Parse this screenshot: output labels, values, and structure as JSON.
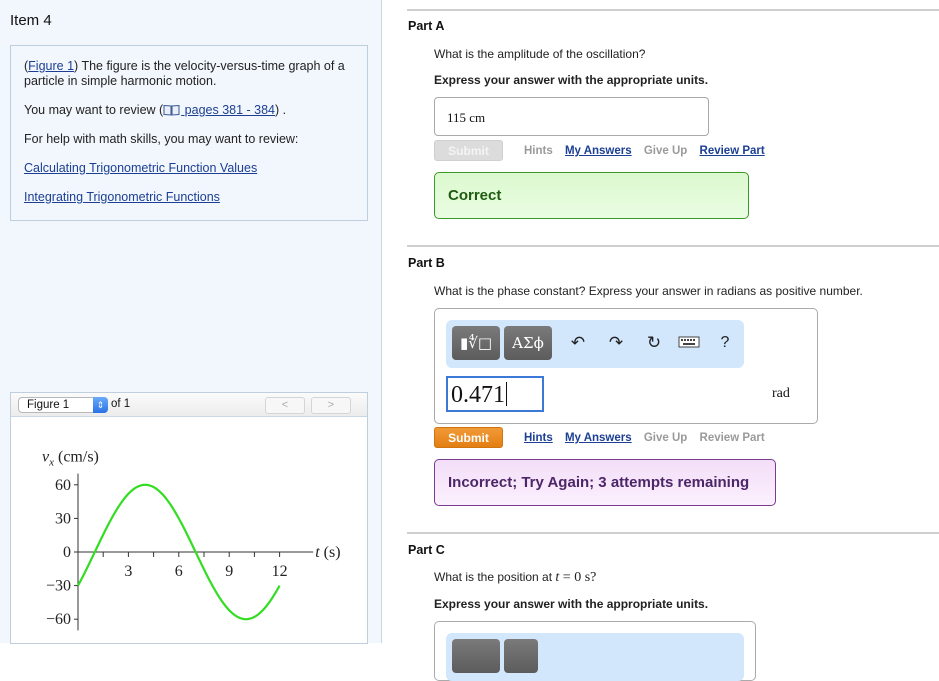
{
  "item": {
    "title": "Item 4",
    "intro": {
      "figure_link": "Figure 1",
      "text_after_link": ") The figure is the velocity-versus-time graph of a particle in simple harmonic motion.",
      "open_paren": "(",
      "review_prefix": "You may want to review (",
      "review_link": " pages 381 - 384",
      "review_suffix": ") .",
      "math_help": "For help with math skills, you may want to review:",
      "link_1": "Calculating Trigonometric Function Values",
      "link_2": "Integrating Trigonometric Functions"
    }
  },
  "figure_panel": {
    "selected": "Figure 1",
    "of_label": "of 1",
    "prev_label": "<",
    "next_label": ">"
  },
  "chart_data": {
    "type": "line",
    "title": "",
    "xlabel": "t (s)",
    "ylabel": "vx (cm/s)",
    "x_ticks": [
      3,
      6,
      9,
      12
    ],
    "x_minor_ticks": [
      1.5,
      4.5,
      7.5,
      10.5
    ],
    "y_ticks": [
      -60,
      -30,
      0,
      30,
      60
    ],
    "xlim": [
      0,
      14
    ],
    "ylim": [
      -70,
      70
    ],
    "grid": false,
    "series": [
      {
        "name": "vx",
        "color": "#33dd22",
        "function": "60*sin(2*pi*t/12 - pi/6)",
        "x": [
          0,
          1,
          2,
          3,
          4,
          5,
          6,
          7,
          8,
          9,
          10,
          11,
          12
        ],
        "values": [
          -30,
          0,
          30,
          52,
          60,
          52,
          30,
          0,
          -30,
          -52,
          -60,
          -52,
          -30
        ]
      }
    ]
  },
  "partA": {
    "label": "Part A",
    "question": "What is the amplitude of the oscillation?",
    "instruction": "Express your answer with the appropriate units.",
    "answer_value": "115 cm",
    "submit": "Submit",
    "hints": "Hints",
    "my_answers": "My Answers",
    "give_up": "Give Up",
    "review_part": "Review Part",
    "feedback": "Correct"
  },
  "partB": {
    "label": "Part B",
    "question": "What is the phase constant? Express your answer in radians as positive number.",
    "toolbar": {
      "templates_label": "▮∜□",
      "symbols_label": "ΑΣϕ",
      "undo": "undo-icon",
      "redo": "redo-icon",
      "reset": "reset-icon",
      "keyboard": "keyboard-icon",
      "help": "?"
    },
    "answer_value": "0.471",
    "unit": "rad",
    "submit": "Submit",
    "hints": "Hints",
    "my_answers": "My Answers",
    "give_up": "Give Up",
    "review_part": "Review Part",
    "feedback": "Incorrect; Try Again; 3 attempts remaining"
  },
  "partC": {
    "label": "Part C",
    "question_prefix": "What is the position at ",
    "question_math_var": "t",
    "question_math_rest": " = 0 s?",
    "instruction": "Express your answer with the appropriate units."
  },
  "colors": {
    "link": "#1c3f94",
    "correct_border": "#3c9a2a",
    "incorrect_border": "#7a3c8f",
    "submit_active": "#e8881f",
    "curve": "#33dd22"
  }
}
